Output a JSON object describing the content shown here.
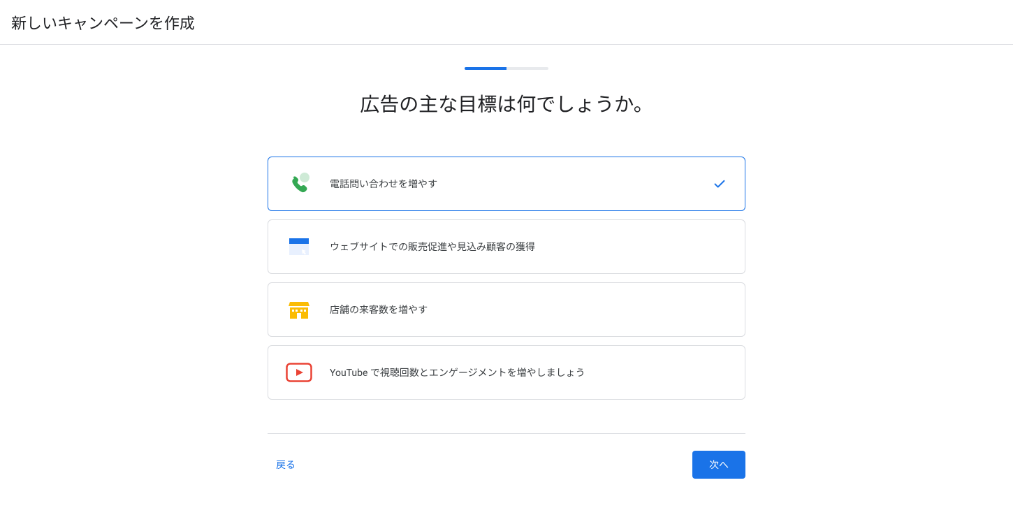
{
  "header": {
    "title": "新しいキャンペーンを作成"
  },
  "progress": {
    "segments": 2,
    "active": 0
  },
  "question": "広告の主な目標は何でしょうか。",
  "options": [
    {
      "label": "電話問い合わせを増やす",
      "selected": true
    },
    {
      "label": "ウェブサイトでの販売促進や見込み顧客の獲得",
      "selected": false
    },
    {
      "label": "店舗の来客数を増やす",
      "selected": false
    },
    {
      "label": "YouTube で視聴回数とエンゲージメントを増やしましょう",
      "selected": false
    }
  ],
  "footer": {
    "back": "戻る",
    "next": "次へ"
  }
}
